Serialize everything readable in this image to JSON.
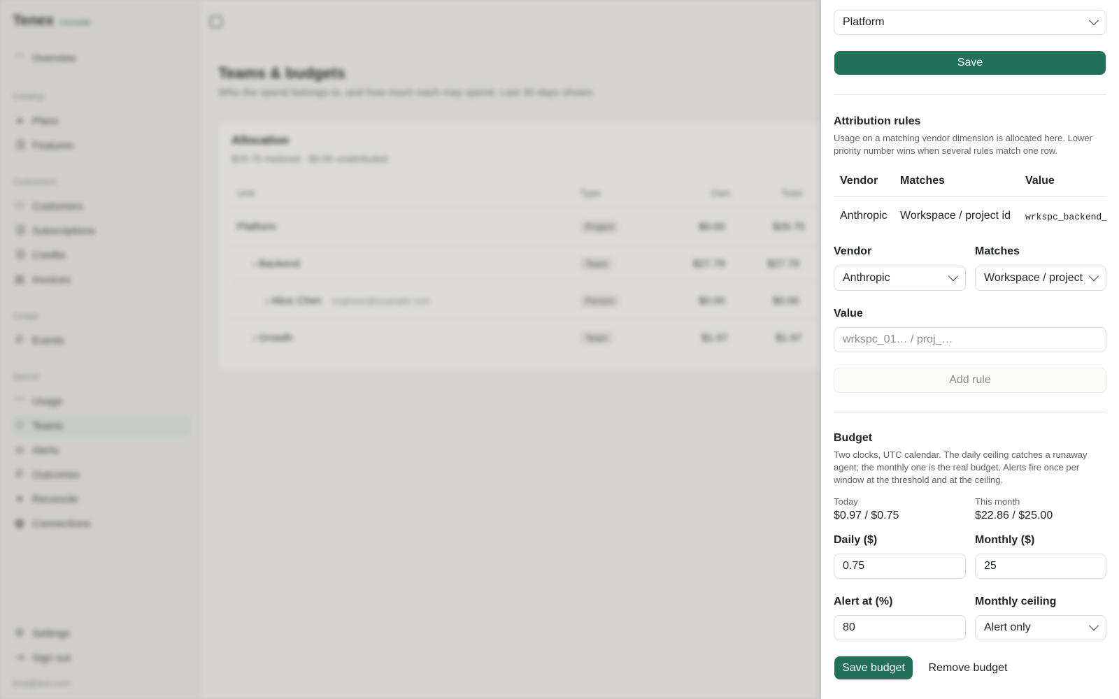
{
  "app": {
    "brand": "Tenex",
    "brand_tag": "console",
    "user_email": "test@test.com"
  },
  "sidebar": {
    "overview": "Overview",
    "sections": {
      "catalog": "Catalog",
      "customers": "Customers",
      "usage": "Usage",
      "spend": "Spend"
    },
    "catalog_items": [
      {
        "label": "Plans",
        "icon": "tag-icon"
      },
      {
        "label": "Features",
        "icon": "link-icon"
      }
    ],
    "customer_items": [
      {
        "label": "Customers",
        "icon": "user-icon"
      },
      {
        "label": "Subscriptions",
        "icon": "link-icon"
      },
      {
        "label": "Credits",
        "icon": "link-icon"
      },
      {
        "label": "Invoices",
        "icon": "invoice-icon"
      }
    ],
    "usage_items": [
      {
        "label": "Events",
        "icon": "phone-icon"
      }
    ],
    "spend_items": [
      {
        "label": "Usage",
        "icon": "gauge-icon"
      },
      {
        "label": "Teams",
        "icon": "user-icon",
        "active": true
      },
      {
        "label": "Alerts",
        "icon": "alert-icon"
      },
      {
        "label": "Outcomes",
        "icon": "phone-icon"
      },
      {
        "label": "Reconcile",
        "icon": "reconcile-icon"
      },
      {
        "label": "Connections",
        "icon": "connections-icon"
      }
    ],
    "settings": "Settings",
    "sign_out": "Sign out"
  },
  "main": {
    "title": "Teams & budgets",
    "subtitle": "Who the spend belongs to, and how much each may spend. Last 30 days shown.",
    "allocation": {
      "title": "Allocation",
      "subtitle": "$29.75 metered · $0.00 unattributed",
      "columns": [
        "Unit",
        "Type",
        "Own",
        "Total"
      ],
      "rows": [
        {
          "unit": "Platform",
          "type": "Project",
          "own": "$0.00",
          "total": "$29.75"
        },
        {
          "unit": "Backend",
          "type": "Team",
          "own": "$27.79",
          "total": "$27.79"
        },
        {
          "unit": "Alice Chen",
          "email": "engineer@example.com",
          "type": "Person",
          "own": "$0.00",
          "total": "$0.00"
        },
        {
          "unit": "Growth",
          "type": "Team",
          "own": "$1.97",
          "total": "$1.97"
        }
      ]
    }
  },
  "drawer": {
    "parent_select": "Platform",
    "save_label": "Save",
    "attribution": {
      "title": "Attribution rules",
      "description": "Usage on a matching vendor dimension is allocated here. Lower priority number wins when several rules match one row.",
      "columns": {
        "vendor": "Vendor",
        "matches": "Matches",
        "value": "Value"
      },
      "rows": [
        {
          "vendor": "Anthropic",
          "matches": "Workspace / project id",
          "value": "wrkspc_backend_"
        }
      ],
      "form": {
        "vendor_label": "Vendor",
        "vendor_value": "Anthropic",
        "matches_label": "Matches",
        "matches_value": "Workspace / project id",
        "value_label": "Value",
        "value_placeholder": "wrkspc_01… / proj_…",
        "add_rule": "Add rule"
      }
    },
    "budget": {
      "title": "Budget",
      "description": "Two clocks, UTC calendar. The daily ceiling catches a runaway agent; the monthly one is the real budget. Alerts fire once per window at the threshold and at the ceiling.",
      "today_label": "Today",
      "today_value": "$0.97 / $0.75",
      "month_label": "This month",
      "month_value": "$22.86 / $25.00",
      "daily_label": "Daily ($)",
      "daily_value": "0.75",
      "monthly_label": "Monthly ($)",
      "monthly_value": "25",
      "alert_label": "Alert at (%)",
      "alert_value": "80",
      "ceiling_label": "Monthly ceiling",
      "ceiling_value": "Alert only",
      "save_budget": "Save budget",
      "remove_budget": "Remove budget"
    }
  },
  "colors": {
    "accent": "#23705a",
    "active_nav": "#dfe6df"
  }
}
